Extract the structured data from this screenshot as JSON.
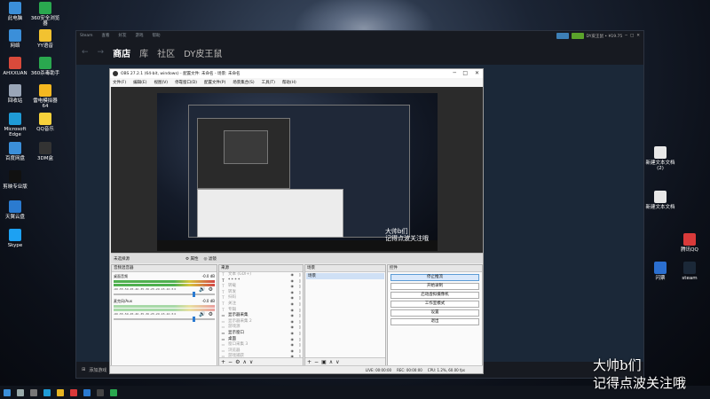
{
  "desktop": {
    "left_icons": [
      {
        "label": "此电脑",
        "color": "#3b8fd9"
      },
      {
        "label": "360安全浏览器",
        "color": "#2aa84f"
      },
      {
        "label": "网络",
        "color": "#3b8fd9"
      },
      {
        "label": "YY语音",
        "color": "#f2c230"
      },
      {
        "label": "AHXXUAN",
        "color": "#d94a3b"
      },
      {
        "label": "360杀毒助手",
        "color": "#2aa84f"
      },
      {
        "label": "回收站",
        "color": "#9aa6b8"
      },
      {
        "label": "雷电模拟器 64",
        "color": "#f5b820"
      },
      {
        "label": "Microsoft Edge",
        "color": "#1f9bd6"
      },
      {
        "label": "QQ音乐",
        "color": "#f7d23b"
      },
      {
        "label": "百度网盘",
        "color": "#3b8fd9"
      },
      {
        "label": "3DM盒",
        "color": "#333"
      },
      {
        "label": "剪映专业版",
        "color": "#111"
      },
      {
        "label": "天翼云盘",
        "color": "#2b7bd0"
      },
      {
        "label": "Skype",
        "color": "#1da1f2"
      }
    ],
    "right_icons": [
      {
        "label": "新建文本文档 (2)",
        "color": "#e8e8e8"
      },
      {
        "label": "新建文本文档",
        "color": "#e8e8e8"
      },
      {
        "label": "腾讯QQ",
        "color": "#d93a3a"
      },
      {
        "label": "闪票",
        "color": "#2b6fd0"
      },
      {
        "label": "steam",
        "color": "#1b2838"
      }
    ]
  },
  "steam": {
    "top_menu": [
      "Steam",
      "查看",
      "好友",
      "游戏",
      "帮助"
    ],
    "nav_tabs": [
      "商店",
      "库",
      "社区",
      "DY皮王鼠"
    ],
    "account": "DY皮王鼠 • ¥19.75",
    "bottom_button": "添加游戏"
  },
  "obs": {
    "title": "OBS 27.2.1 (64-bit, windows) - 配置文件: 未命名 - 场景: 未命名",
    "menu": [
      "文件(F)",
      "编辑(E)",
      "视图(V)",
      "停靠窗口(D)",
      "配置文件(P)",
      "场景集合(S)",
      "工具(T)",
      "帮助(H)"
    ],
    "toolbar": {
      "no_source": "未选择源",
      "properties": "属性",
      "filters": "滤镜"
    },
    "preview_caption": [
      "大帅b们",
      "记得点波关注哦"
    ],
    "docks": {
      "mixer": "音频混音器",
      "sources": "来源",
      "scenes": "场景",
      "controls": "控件"
    },
    "mixer_tracks": [
      {
        "name": "桌面音频",
        "db": "-0.0 dB",
        "active": true
      },
      {
        "name": "麦克风/Aux",
        "db": "-0.0 dB",
        "active": false
      }
    ],
    "mixer_scale": "-60 -55 -50 -45 -40 -35 -30 -25 -20 -15 -10 -5 0",
    "sources": [
      {
        "icon": "T",
        "label": "文本 (GDI+)",
        "dim": true
      },
      {
        "icon": "T",
        "label": "* * * *",
        "dim": false
      },
      {
        "icon": "T",
        "label": "转载",
        "dim": true
      },
      {
        "icon": "T",
        "label": "转发",
        "dim": true
      },
      {
        "icon": "T",
        "label": "扫码",
        "dim": true
      },
      {
        "icon": "T",
        "label": "关注",
        "dim": true
      },
      {
        "icon": "T",
        "label": "专辑",
        "dim": true
      },
      {
        "icon": "▭",
        "label": "显示器采集",
        "dim": false
      },
      {
        "icon": "▭",
        "label": "显示器采集 2",
        "dim": true
      },
      {
        "icon": "▭",
        "label": "游戏源",
        "dim": true
      },
      {
        "icon": "▭",
        "label": "显示窗口",
        "dim": false
      },
      {
        "icon": "▭",
        "label": "桌面",
        "dim": false
      },
      {
        "icon": "▭",
        "label": "窗口采集 3",
        "dim": true
      },
      {
        "icon": "▭",
        "label": "浏览器",
        "dim": true
      },
      {
        "icon": "▭",
        "label": "游戏捕获",
        "dim": true
      }
    ],
    "scenes": [
      "场景"
    ],
    "controls": [
      "停止推流",
      "开始录制",
      "启动虚拟摄像机",
      "工作室模式",
      "设置",
      "退出"
    ],
    "status": {
      "live": "LIVE: 00:00:00",
      "rec": "REC: 00:00:00",
      "cpu": "CPU: 1.2%, 60.00 fps"
    }
  },
  "overlay_caption": [
    "大帅b们",
    "记得点波关注哦"
  ],
  "colors": {
    "obs_highlight": "#cfe0f5",
    "steam_bg": "#1b2838",
    "accent_green": "#4fb04f"
  }
}
